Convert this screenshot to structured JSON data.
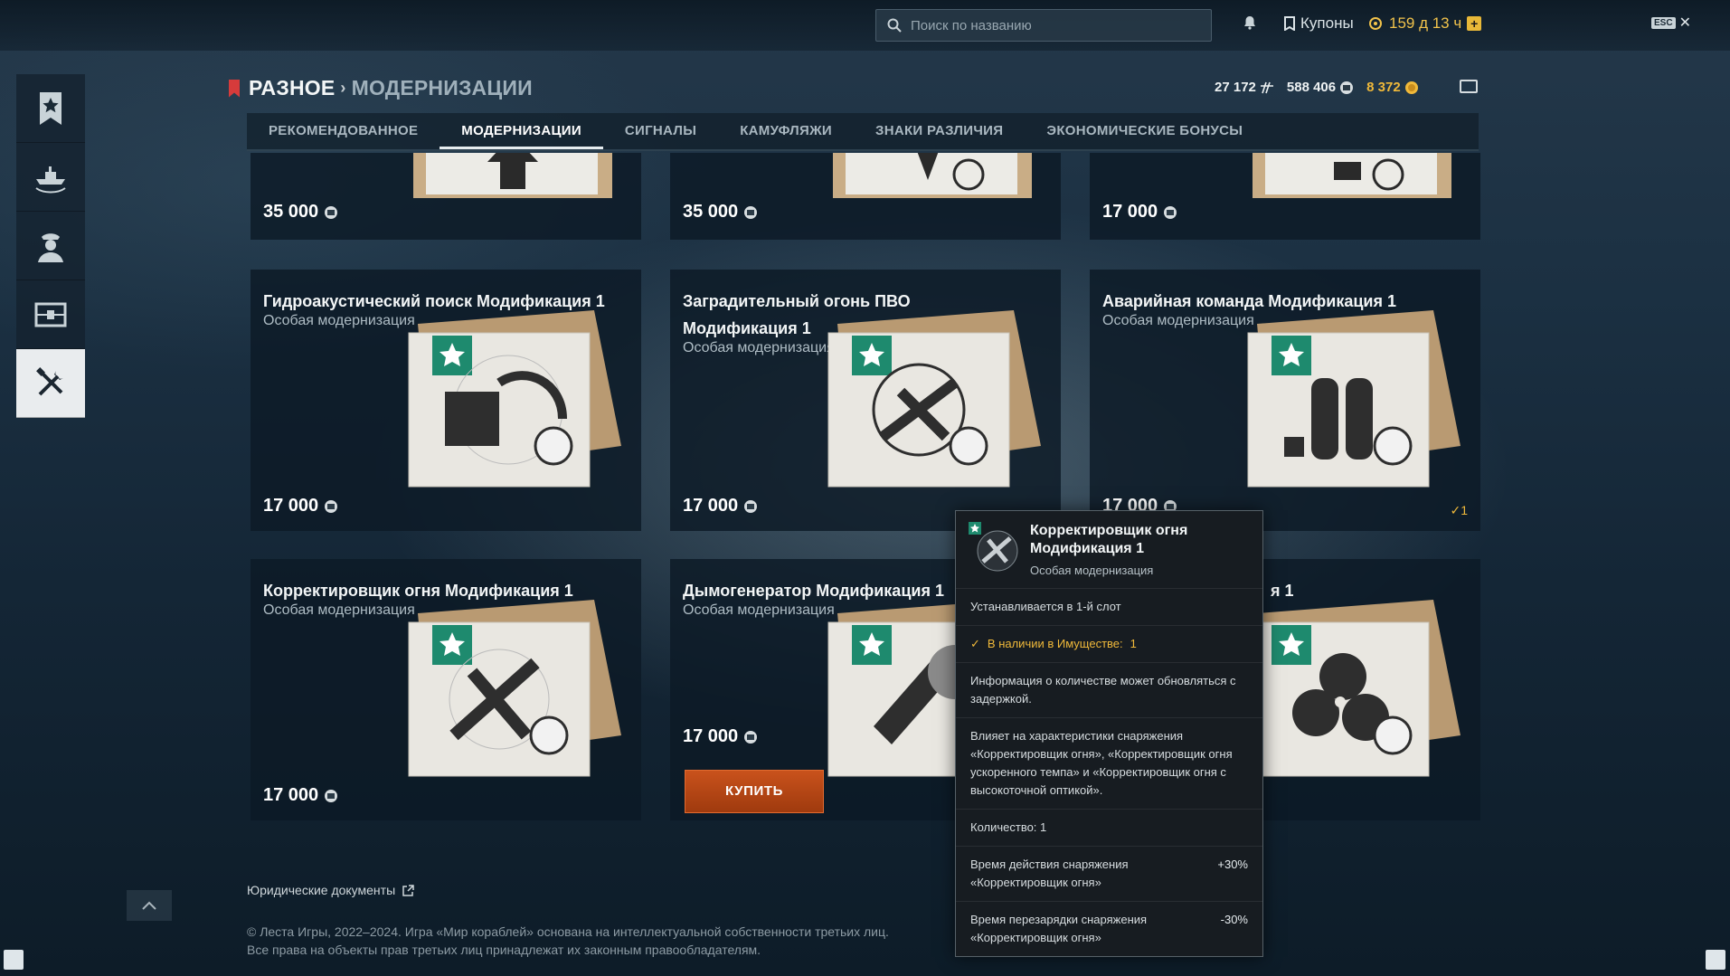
{
  "topbar": {
    "search_placeholder": "Поиск по названию",
    "coupons_label": "Купоны",
    "premium_time": "159 д 13 ч",
    "esc_label": "ESC"
  },
  "header": {
    "section": "РАЗНОЕ",
    "subsection": "МОДЕРНИЗАЦИИ",
    "balances": {
      "free_xp": "27 172",
      "credits": "588 406",
      "doubloons": "8 372"
    }
  },
  "tabs": [
    {
      "label": "РЕКОМЕНДОВАННОЕ"
    },
    {
      "label": "МОДЕРНИЗАЦИИ"
    },
    {
      "label": "СИГНАЛЫ"
    },
    {
      "label": "КАМУФЛЯЖИ"
    },
    {
      "label": "ЗНАКИ РАЗЛИЧИЯ"
    },
    {
      "label": "ЭКОНОМИЧЕСКИЕ БОНУСЫ"
    }
  ],
  "cards_top": [
    {
      "price": "35 000"
    },
    {
      "price": "35 000"
    },
    {
      "price": "17 000"
    }
  ],
  "cards_mid": [
    {
      "name": "Гидроакустический поиск Модификация 1",
      "sub": "Особая модернизация",
      "price": "17 000"
    },
    {
      "name": "Заградительный огонь ПВО Модификация 1",
      "sub": "Особая модернизация",
      "price": "17 000"
    },
    {
      "name": "Аварийная команда Модификация 1",
      "sub": "Особая модернизация",
      "price": "17 000",
      "owned": "1"
    }
  ],
  "cards_bot": [
    {
      "name": "Корректировщик огня Модификация 1",
      "sub": "Особая модернизация",
      "price": "17 000"
    },
    {
      "name": "Дымогенератор Модификация 1",
      "sub": "Особая модернизация",
      "price": "17 000",
      "buy_label": "КУПИТЬ"
    },
    {
      "name_tail": "я 1"
    }
  ],
  "tooltip": {
    "title": "Корректировщик огня Модификация 1",
    "sub": "Особая модернизация",
    "slot": "Устанавливается в 1-й слот",
    "available_label": "В наличии в Имуществе:",
    "available_count": "1",
    "info": "Информация о количестве может обновляться с задержкой.",
    "affects": "Влияет на характеристики снаряжения «Корректировщик огня», «Корректировщик огня ускоренного темпа» и «Корректировщик огня с высокоточной оптикой».",
    "quantity": "Количество: 1",
    "stats": [
      {
        "label": "Время действия снаряжения «Корректировщик огня»",
        "value": "+30%"
      },
      {
        "label": "Время перезарядки снаряжения «Корректировщик огня»",
        "value": "-30%"
      }
    ]
  },
  "footer": {
    "legal_label": "Юридические документы",
    "copyright_line1": "© Леста Игры, 2022–2024. Игра «Мир кораблей» основана на интеллектуальной собственности третьих лиц.",
    "copyright_line2": "Все права на объекты прав третьих лиц принадлежат их законным правообладателям."
  }
}
